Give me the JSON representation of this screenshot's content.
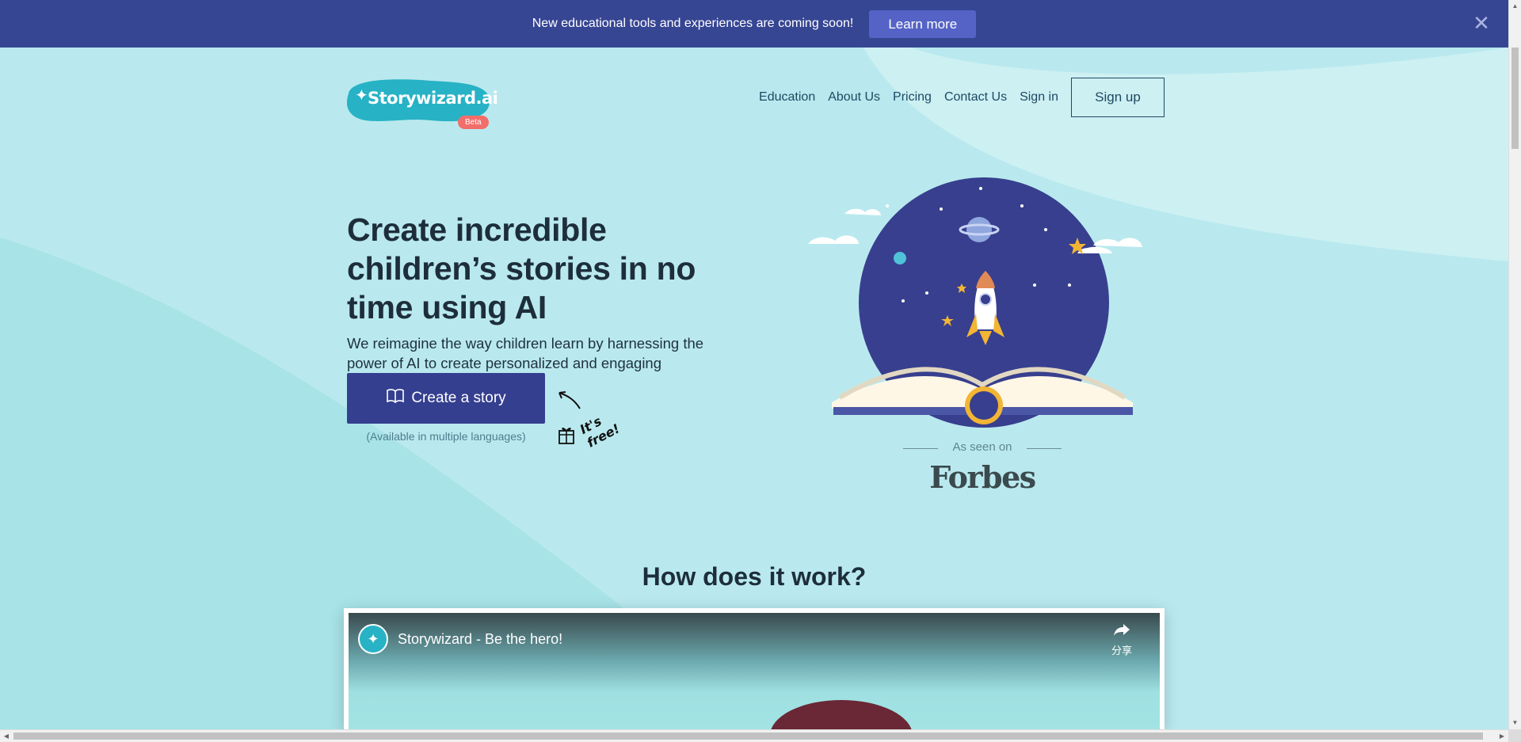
{
  "announcement": {
    "text": "New educational tools and experiences are coming soon!",
    "button_label": "Learn more",
    "close_icon": "close-icon"
  },
  "header": {
    "logo_text": "Storywizard.ai",
    "beta_label": "Beta",
    "nav": [
      "Education",
      "About Us",
      "Pricing",
      "Contact Us",
      "Sign in"
    ],
    "signup_label": "Sign up"
  },
  "hero": {
    "title": "Create incredible children’s stories in no time using AI",
    "description": "We reimagine the way children learn by harnessing the power of AI to create personalized and engaging educational experiences.",
    "cta_label": "Create a story",
    "cta_icon": "book-icon",
    "cta_note": "(Available in multiple languages)",
    "free_label": "It's free!"
  },
  "press": {
    "seen_label": "As seen on",
    "outlet": "Forbes"
  },
  "how_it_works": {
    "title": "How does it work?",
    "video_title": "Storywizard - Be the hero!",
    "share_label": "分享"
  },
  "colors": {
    "announce_bg": "#374693",
    "page_bg": "#b9e9ee",
    "accent": "#353f8f",
    "beta": "#f26e6a",
    "logo": "#27b2c5"
  }
}
